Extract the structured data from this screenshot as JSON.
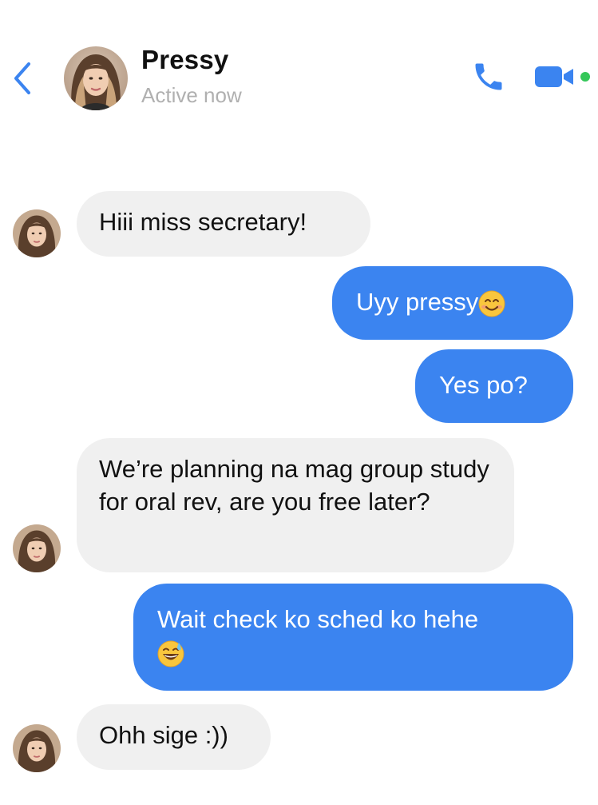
{
  "header": {
    "name": "Pressy",
    "status": "Active now",
    "icons": {
      "back": "chevron-left-icon",
      "call": "phone-icon",
      "video": "video-camera-icon"
    },
    "accent": "#3b84f0",
    "online_color": "#35c759"
  },
  "messages": [
    {
      "direction": "incoming",
      "text": "Hiii miss secretary!"
    },
    {
      "direction": "outgoing",
      "text": "Uyy pressy",
      "emoji": "smiling-face-emoji"
    },
    {
      "direction": "outgoing",
      "text": "Yes po?"
    },
    {
      "direction": "incoming",
      "text": "We’re planning na mag group study for oral rev, are you free later?"
    },
    {
      "direction": "outgoing",
      "text": "Wait check ko sched ko hehe",
      "emoji": "grinning-sweat-emoji"
    },
    {
      "direction": "incoming",
      "text": "Ohh sige :))"
    }
  ],
  "colors": {
    "incoming_bubble": "#f0f0f0",
    "outgoing_bubble": "#3b84f0"
  }
}
